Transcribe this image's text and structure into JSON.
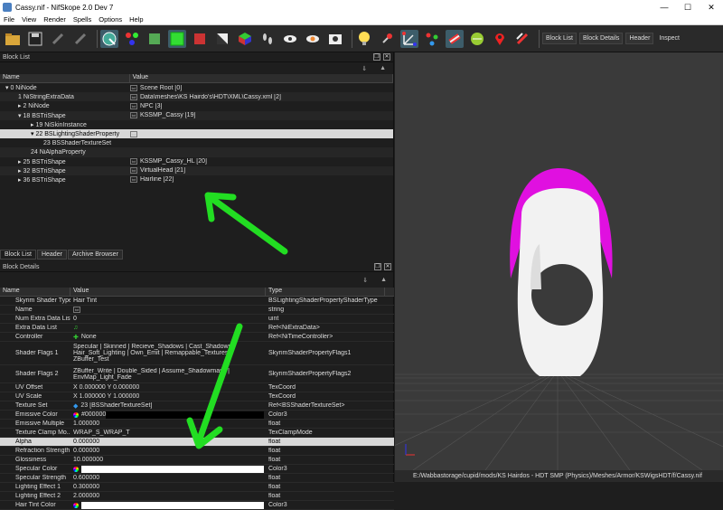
{
  "window": {
    "title": "Cassy.nif - NifSkope 2.0 Dev 7",
    "min": "—",
    "max": "☐",
    "close": "✕"
  },
  "menu": [
    "File",
    "View",
    "Render",
    "Spells",
    "Options",
    "Help"
  ],
  "toolbar": {
    "labels": [
      "Block List",
      "Block Details",
      "Header",
      "Inspect"
    ]
  },
  "block_list": {
    "title": "Block List",
    "columns": [
      "Name",
      "Value"
    ],
    "rows": [
      {
        "name": "▾ 0 NiNode",
        "value": "Scene Root [0]",
        "txt": true
      },
      {
        "name": "1 NiStringExtraData",
        "value": "Data\\meshes\\KS Hairdo's\\HDT\\XML\\Cassy.xml [2]",
        "txt": true
      },
      {
        "name": "▸ 2 NiNode",
        "value": "NPC [3]",
        "txt": true
      },
      {
        "name": "▾ 18 BSTriShape",
        "value": "KSSMP_Cassy [19]",
        "txt": true
      },
      {
        "name": "▸ 19 NiSkinInstance",
        "value": ""
      },
      {
        "name": "▾ 22 BSLightingShaderProperty",
        "value": "",
        "txt": true
      },
      {
        "name": "23 BSShaderTextureSet",
        "value": ""
      },
      {
        "name": "24 NiAlphaProperty",
        "value": ""
      },
      {
        "name": "▸ 25 BSTriShape",
        "value": "KSSMP_Cassy_HL [20]",
        "txt": true
      },
      {
        "name": "▸ 32 BSTriShape",
        "value": "VirtualHead [21]",
        "txt": true
      },
      {
        "name": "▸ 36 BSTriShape",
        "value": "Hairline [22]",
        "txt": true
      }
    ],
    "txt_icon": "txt"
  },
  "tabs": [
    "Block List",
    "Header",
    "Archive Browser"
  ],
  "block_details": {
    "title": "Block Details",
    "columns": [
      "Name",
      "Value",
      "Type"
    ],
    "rows": [
      {
        "name": "Skyrim Shader Type",
        "value": "Hair Tint",
        "type": "BSLightingShaderPropertyShaderType"
      },
      {
        "name": "Name",
        "value": "",
        "type": "string",
        "txt": true
      },
      {
        "name": "Num Extra Data List",
        "value": "0",
        "type": "uint"
      },
      {
        "name": "Extra Data List",
        "value": "",
        "type": "Ref<NiExtraData>"
      },
      {
        "name": "Controller",
        "value": "None",
        "type": "Ref<NiTimeController>"
      },
      {
        "name": "Shader Flags 1",
        "value": "Specular | Skinned | Recieve_Shadows | Cast_Shadows | Hair_Soft_Lighting | Own_Emit | Remappable_Textures | ZBuffer_Test",
        "type": "SkyrimShaderPropertyFlags1",
        "tall": true
      },
      {
        "name": "Shader Flags 2",
        "value": "ZBuffer_Write | Double_Sided | Assume_Shadowmask | EnvMap_Light_Fade",
        "type": "SkyrimShaderPropertyFlags2",
        "tall": true
      },
      {
        "name": "UV Offset",
        "value": "X 0.000000 Y 0.000000",
        "type": "TexCoord"
      },
      {
        "name": "UV Scale",
        "value": "X 1.000000 Y 1.000000",
        "type": "TexCoord"
      },
      {
        "name": "Texture Set",
        "value": "23 [BSShaderTextureSet]",
        "type": "Ref<BSShaderTextureSet>"
      },
      {
        "name": "Emissive Color",
        "value": "#000000",
        "type": "Color3",
        "bar": "#000000"
      },
      {
        "name": "Emissive Multiple",
        "value": "1.000000",
        "type": "float"
      },
      {
        "name": "Texture Clamp Mo...",
        "value": "WRAP_S_WRAP_T",
        "type": "TexClampMode"
      },
      {
        "name": "Alpha",
        "value": "0.000000",
        "type": "float",
        "sel": true
      },
      {
        "name": "Refraction Strength",
        "value": "0.000000",
        "type": "float"
      },
      {
        "name": "Glossiness",
        "value": "10.000000",
        "type": "float"
      },
      {
        "name": "Specular Color",
        "value": "",
        "type": "Color3",
        "bar": "#ffffff"
      },
      {
        "name": "Specular Strength",
        "value": "0.600000",
        "type": "float"
      },
      {
        "name": "Lighting Effect 1",
        "value": "0.300000",
        "type": "float"
      },
      {
        "name": "Lighting Effect 2",
        "value": "2.000000",
        "type": "float"
      },
      {
        "name": "Hair Tint Color",
        "value": "",
        "type": "Color3",
        "bar": "#ffffff"
      }
    ]
  },
  "status": "E:/Wabbastorage/cupid/mods/KS Hairdos - HDT SMP (Physics)/Meshes/Armor/KSWigsHDT/f/Cassy.nif",
  "colors": {
    "hair": "#e010e0",
    "head": "#f2f2f2",
    "arrow": "#22dd22"
  }
}
